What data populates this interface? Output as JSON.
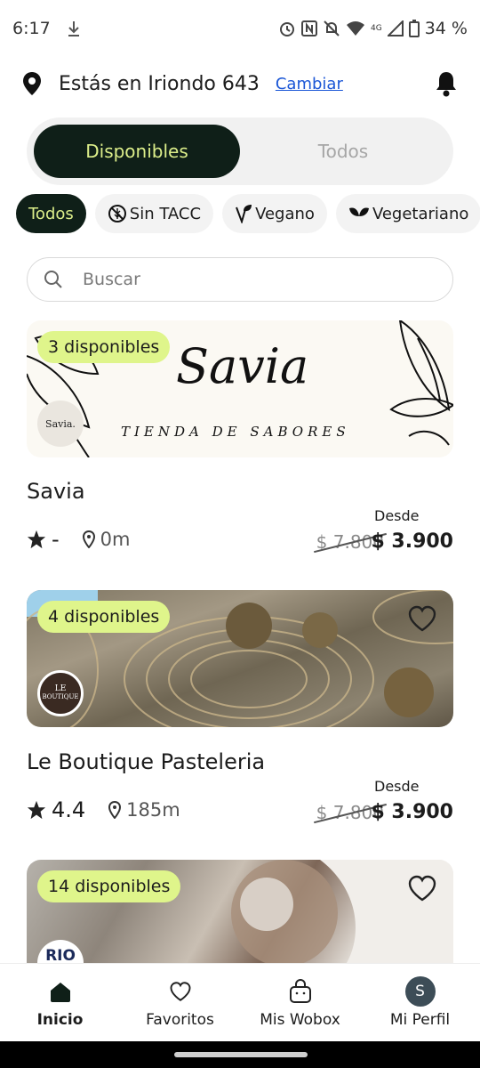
{
  "status_bar": {
    "time": "6:17",
    "network": "4G",
    "battery": "34 %"
  },
  "header": {
    "location_text": "Estás en Iriondo 643",
    "change_link": "Cambiar"
  },
  "tabs": [
    {
      "label": "Disponibles",
      "active": true
    },
    {
      "label": "Todos",
      "active": false
    }
  ],
  "filters": [
    {
      "label": "Todos",
      "active": true
    },
    {
      "label": "Sin TACC",
      "icon": "gluten-free-icon"
    },
    {
      "label": "Vegano",
      "icon": "vegan-icon"
    },
    {
      "label": "Vegetariano",
      "icon": "vegetarian-icon"
    }
  ],
  "search": {
    "placeholder": "Buscar"
  },
  "stores": [
    {
      "badge": "3 disponibles",
      "name": "Savia",
      "rating": "-",
      "distance": "0m",
      "price_label": "Desde",
      "price_old": "$ 7.800",
      "price_new": "$ 3.900",
      "banner_title": "Savia",
      "banner_subtitle": "TIENDA DE SABORES",
      "logo_text": "Savia."
    },
    {
      "badge": "4 disponibles",
      "name": "Le Boutique Pasteleria",
      "rating": "4.4",
      "distance": "185m",
      "price_label": "Desde",
      "price_old": "$ 7.800",
      "price_new": "$ 3.900",
      "logo_text_1": "LE",
      "logo_text_2": "BOUTIQUE"
    },
    {
      "badge": "14 disponibles",
      "logo_text": "RIO"
    }
  ],
  "bottom_nav": [
    {
      "label": "Inicio",
      "icon": "home-icon",
      "active": true
    },
    {
      "label": "Favoritos",
      "icon": "heart-icon"
    },
    {
      "label": "Mis Wobox",
      "icon": "bag-icon"
    },
    {
      "label": "Mi Perfil",
      "avatar_letter": "S"
    }
  ],
  "colors": {
    "dark_green": "#0f1f18",
    "accent_lime": "#dff58b",
    "link_blue": "#1a56d6"
  }
}
